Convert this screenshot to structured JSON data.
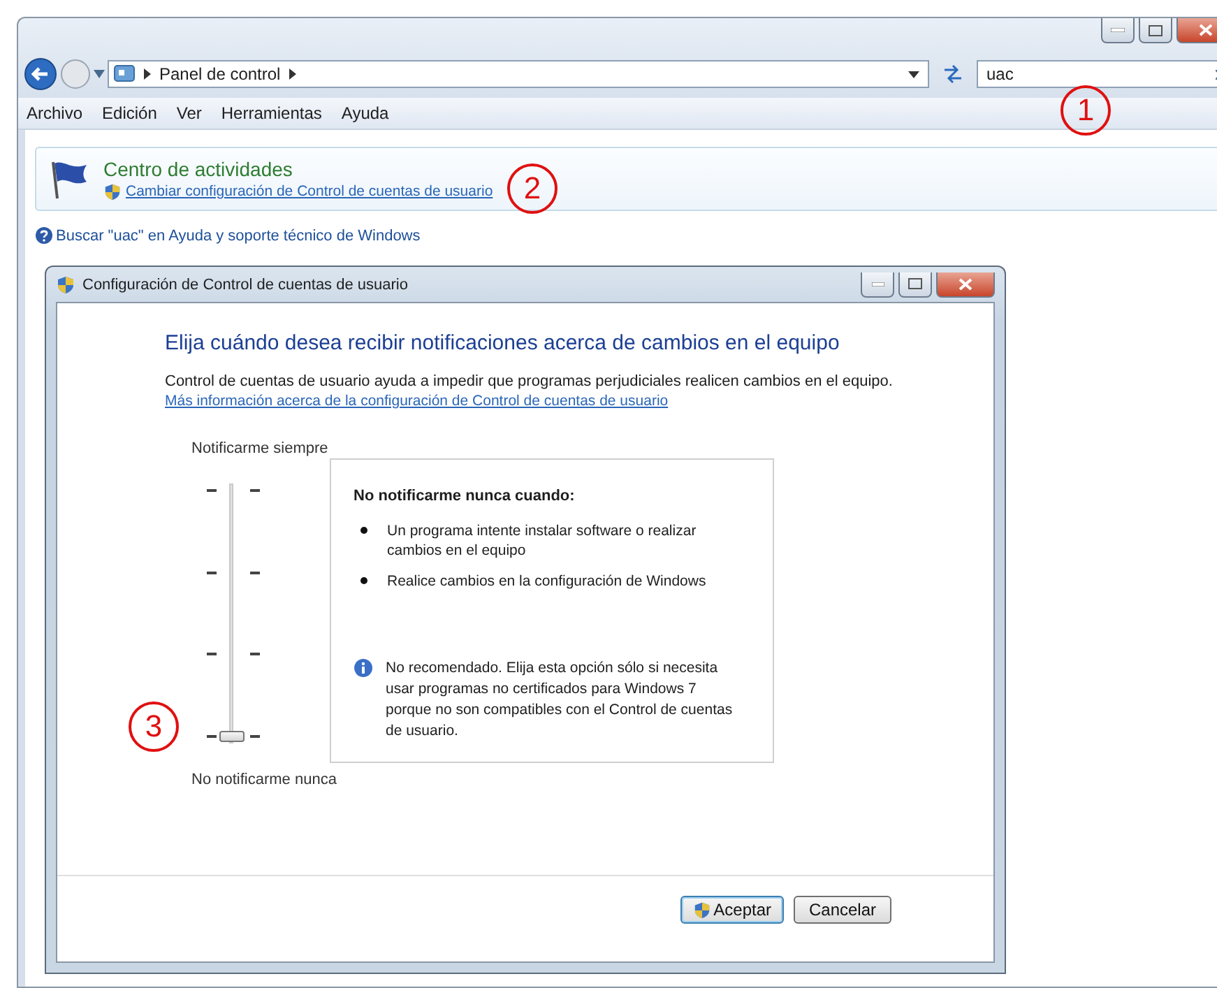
{
  "address_bar": {
    "breadcrumb": [
      "Panel de control"
    ]
  },
  "search": {
    "value": "uac"
  },
  "menu": [
    "Archivo",
    "Edición",
    "Ver",
    "Herramientas",
    "Ayuda"
  ],
  "results": {
    "group_title": "Centro de actividades",
    "link": "Cambiar configuración de Control de cuentas de usuario"
  },
  "help_link": "Buscar \"uac\" en Ayuda y soporte técnico de Windows",
  "dialog": {
    "title": "Configuración de Control de cuentas de usuario",
    "heading": "Elija cuándo desea recibir notificaciones acerca de cambios en el equipo",
    "description": "Control de cuentas de usuario ayuda a impedir que programas perjudiciales realicen cambios en el equipo.",
    "more_info_link": "Más información acerca de la configuración de Control de cuentas de usuario",
    "slider": {
      "top_label": "Notificarme siempre",
      "bottom_label": "No notificarme nunca",
      "level": 0
    },
    "info_box": {
      "title": "No notificarme nunca cuando:",
      "bullets": [
        "Un programa intente instalar software o realizar cambios en el equipo",
        "Realice cambios en la configuración de Windows"
      ],
      "note": "No recomendado. Elija esta opción sólo si necesita usar programas no certificados para Windows 7 porque no son compatibles con el Control de cuentas de usuario."
    },
    "buttons": [
      {
        "label": "Aceptar",
        "default": true,
        "shield": true
      },
      {
        "label": "Cancelar",
        "default": false,
        "shield": false
      }
    ]
  },
  "annotations": [
    "1",
    "2",
    "3"
  ]
}
